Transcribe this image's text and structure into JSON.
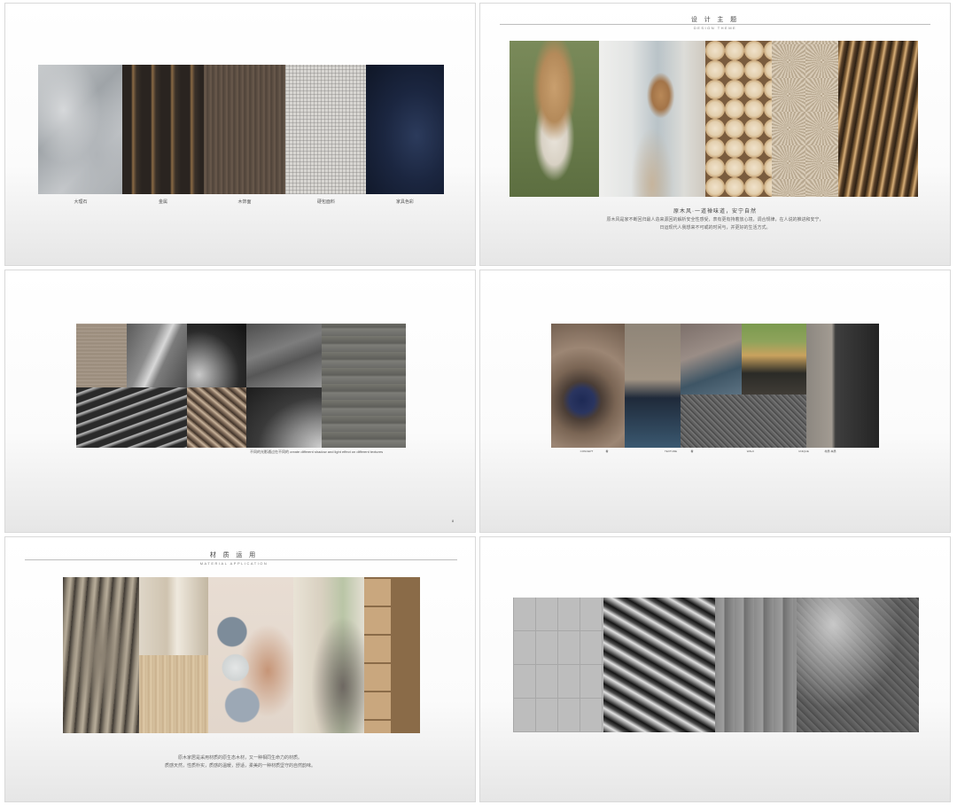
{
  "slides": {
    "s1": {
      "captions": [
        "大理石",
        "金属",
        "木饰面",
        "硬包面料",
        "家具色彩"
      ]
    },
    "s2": {
      "title_cn": "设 计 主 题",
      "title_en": "DESIGN THEME",
      "lead": "原木风·一道禅味道，安宁自然",
      "line1": "原木风是家不断回归最人造来源回的解析安全性感受，表有更有持着放心境，调合规律，在人说的推进和安宁，",
      "line2": "日运现代人我想来不可或的时间与，并更好的生活方式。"
    },
    "s3": {
      "caption_cn": "不同的光影通过在不同的",
      "caption_en": "create different shadow and light effect on different textures",
      "page_number": "8"
    },
    "s4": {
      "captions": [
        "CONCEPT",
        "看",
        "TEXTURE",
        "看",
        "WALK",
        "UNIQUE",
        "材质·本质"
      ]
    },
    "s5": {
      "title_cn": "材 质 运 用",
      "title_en": "MATERIAL APPLICATION",
      "line1": "原木家居是采用材质的原生态木材，又一种相同生命力的材质。",
      "line2": "质感天然，性质朴实，质感的温暖，舒适，柔美的一种材质坚守的自然韵味。"
    }
  }
}
